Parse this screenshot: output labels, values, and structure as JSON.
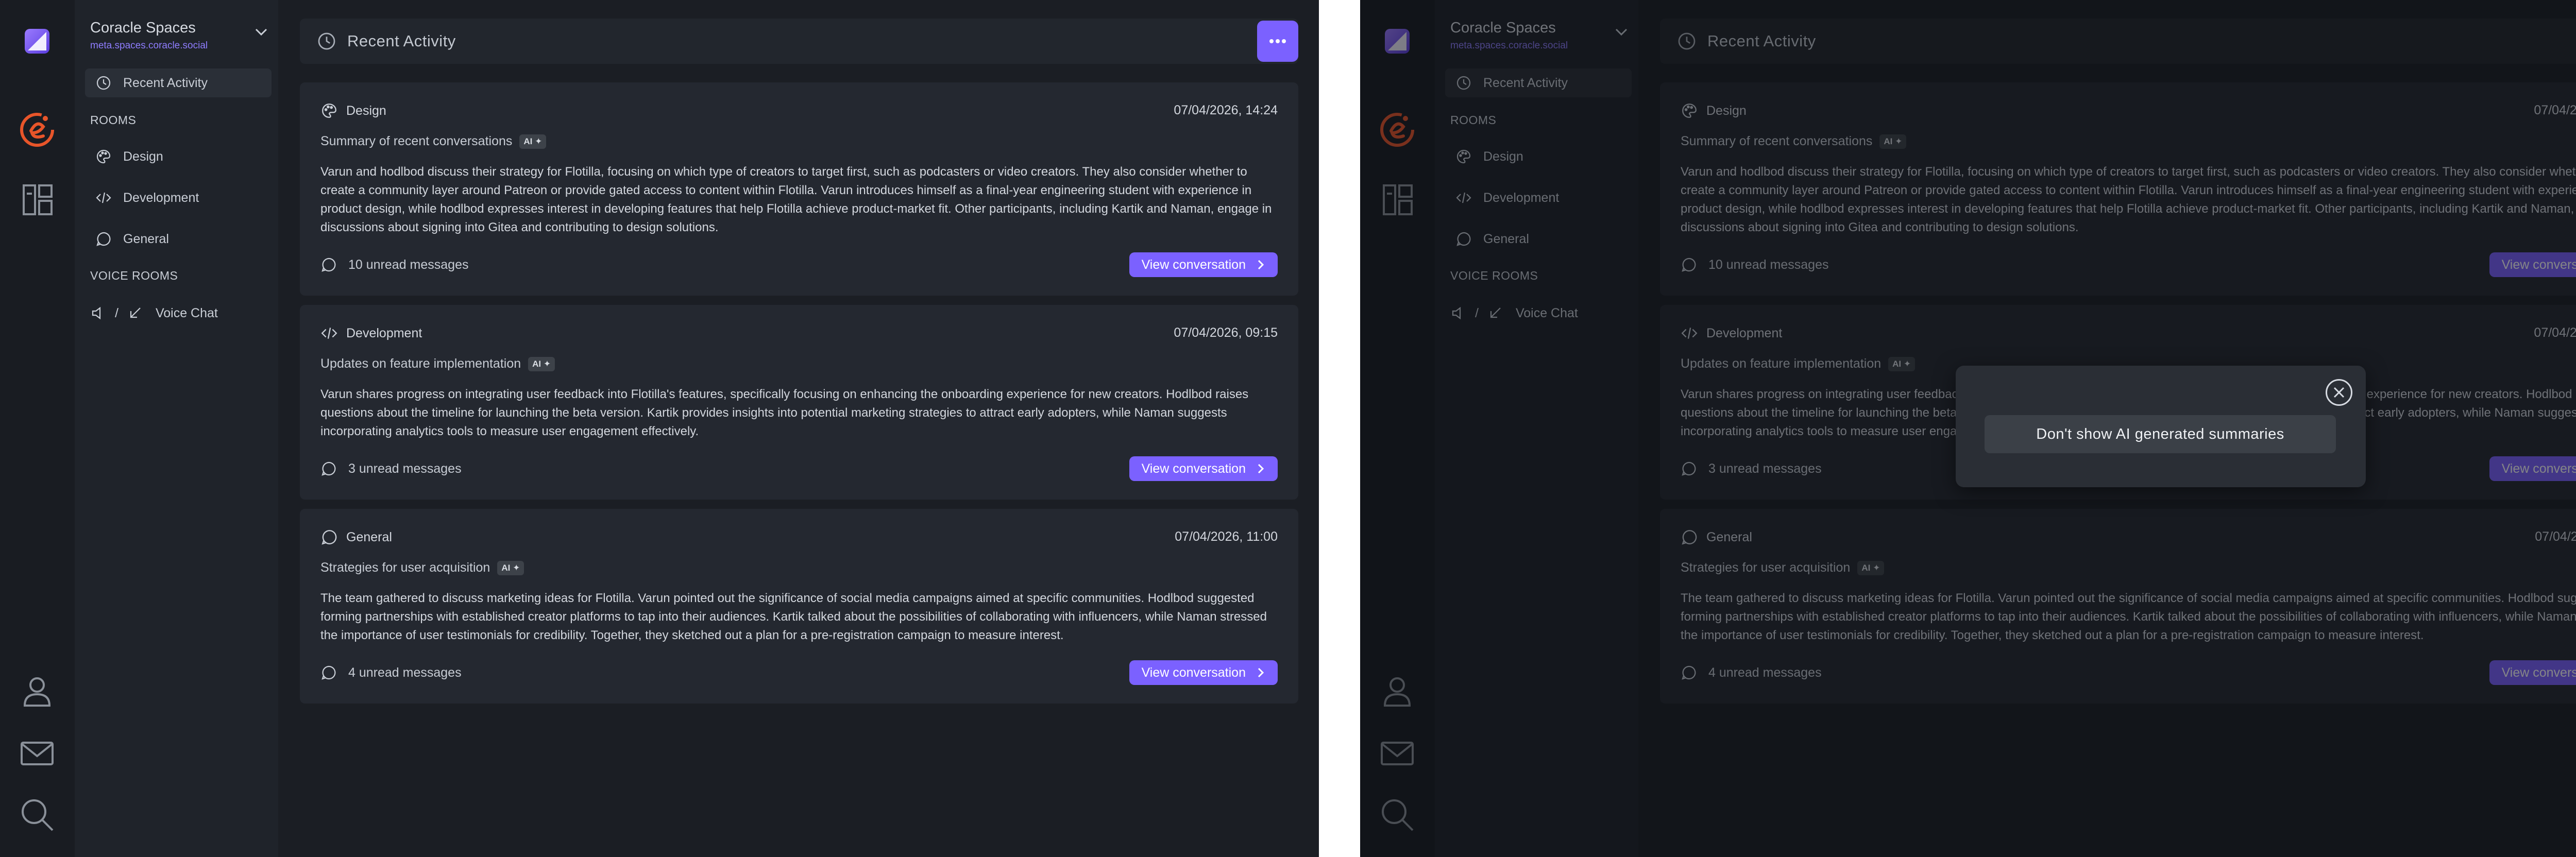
{
  "space": {
    "name": "Coracle Spaces",
    "domain": "meta.spaces.coracle.social"
  },
  "sidebar": {
    "recent_label": "Recent Activity",
    "rooms_label": "ROOMS",
    "rooms": [
      "Design",
      "Development",
      "General"
    ],
    "voice_rooms_label": "VOICE ROOMS",
    "voice_sep": "/",
    "voice_chat_label": "Voice Chat"
  },
  "header": {
    "title": "Recent Activity",
    "more_icon": "more-dots-icon"
  },
  "ai_badge": "AI ✦",
  "view_label": "View conversation",
  "cards": [
    {
      "room": "Design",
      "room_icon": "palette-icon",
      "date": "07/04/2026, 14:24",
      "subtitle": "Summary of recent conversations",
      "body": "Varun and hodlbod discuss their strategy for Flotilla, focusing on which type of creators to target first, such as podcasters or video creators. They also consider whether to create a community layer around Patreon or provide gated access to content within Flotilla. Varun introduces himself as a final-year engineering student with experience in product design, while hodlbod expresses interest in developing features that help Flotilla achieve product-market fit. Other participants, including Kartik and Naman, engage in discussions about signing into Gitea and contributing to design solutions.",
      "unread": "10 unread messages"
    },
    {
      "room": "Development",
      "room_icon": "code-icon",
      "date": "07/04/2026, 09:15",
      "subtitle": "Updates on feature implementation",
      "body": "Varun shares progress on integrating user feedback into Flotilla's features, specifically focusing on enhancing the onboarding experience for new creators. Hodlbod raises questions about the timeline for launching the beta version. Kartik provides insights into potential marketing strategies to attract early adopters, while Naman suggests incorporating analytics tools to measure user engagement effectively.",
      "unread": "3 unread messages"
    },
    {
      "room": "General",
      "room_icon": "chat-bubble-icon",
      "date": "07/04/2026, 11:00",
      "subtitle": "Strategies for user acquisition",
      "body": "The team gathered to discuss marketing ideas for Flotilla. Varun pointed out the significance of social media campaigns aimed at specific communities. Hodlbod suggested forming partnerships with established creator platforms to tap into their audiences. Kartik talked about the possibilities of collaborating with influencers, while Naman stressed the importance of user testimonials for credibility. Together, they sketched out a plan for a pre-registration campaign to measure interest.",
      "unread": "4 unread messages"
    }
  ],
  "popup": {
    "button_label": "Don't show AI generated summaries"
  },
  "colors": {
    "accent": "#7b61ff",
    "accent_text": "#8f7dff",
    "logo_orange": "#e8552a"
  }
}
